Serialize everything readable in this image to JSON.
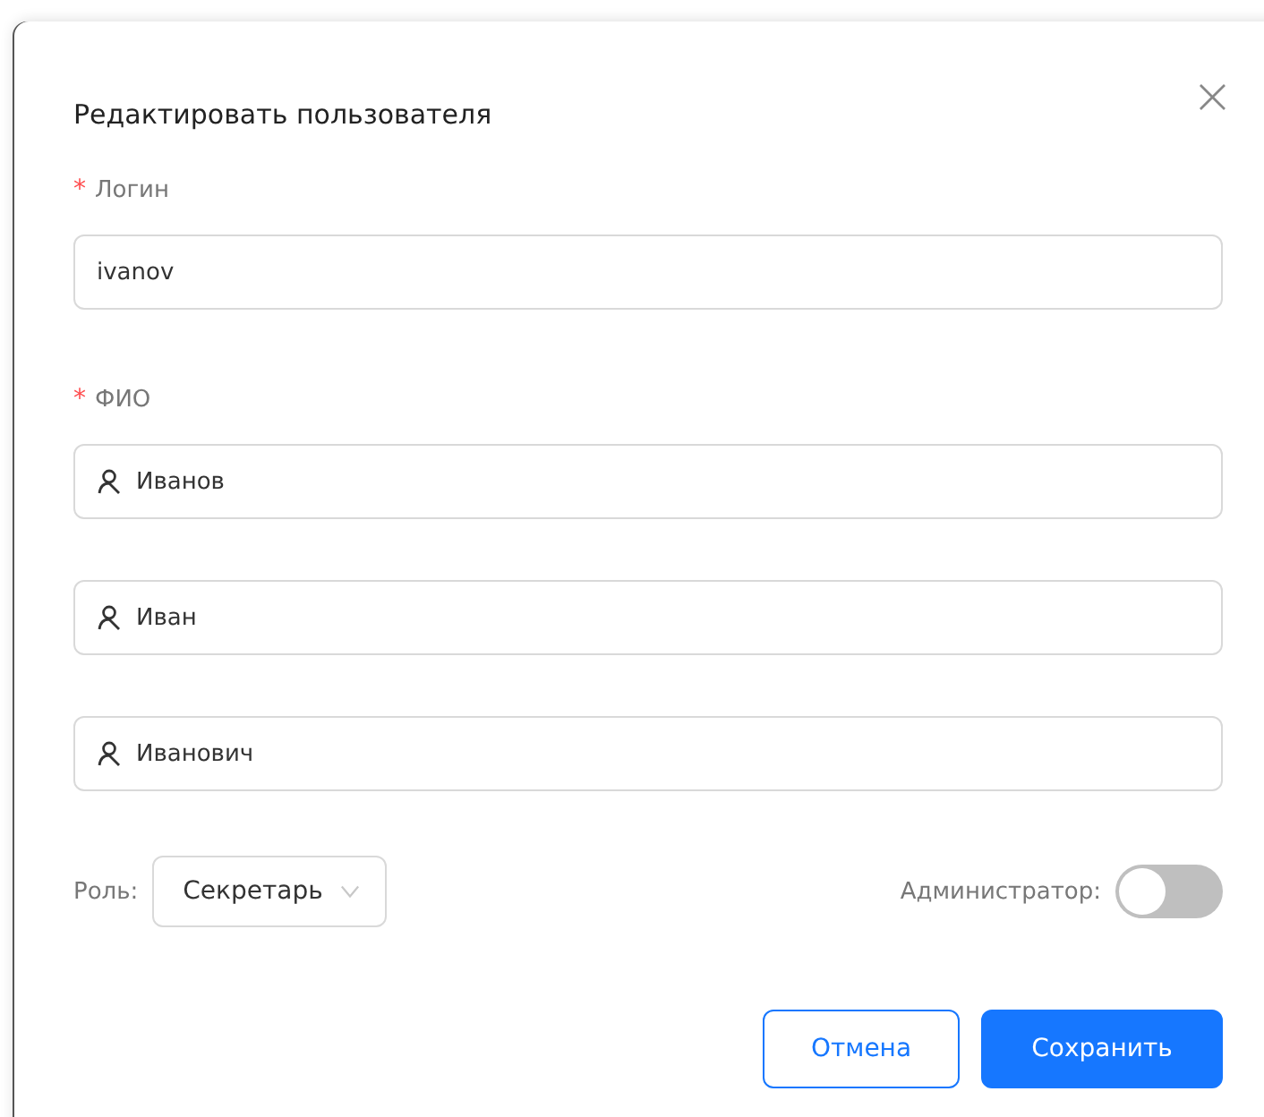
{
  "dialog": {
    "title": "Редактировать пользователя",
    "close": "×"
  },
  "login": {
    "mark": "*",
    "label": "Логин",
    "value": "ivanov"
  },
  "fio": {
    "mark": "*",
    "label": "ФИО",
    "fields": [
      {
        "value": "Иванов"
      },
      {
        "value": "Иван"
      },
      {
        "value": "Иванович"
      }
    ]
  },
  "role": {
    "label": "Роль:",
    "value": "Секретарь"
  },
  "admin": {
    "label": "Администратор:",
    "on": false
  },
  "buttons": [
    {
      "label": "Отмена",
      "kind": "secondary"
    },
    {
      "label": "Сохранить",
      "kind": "primary"
    }
  ]
}
